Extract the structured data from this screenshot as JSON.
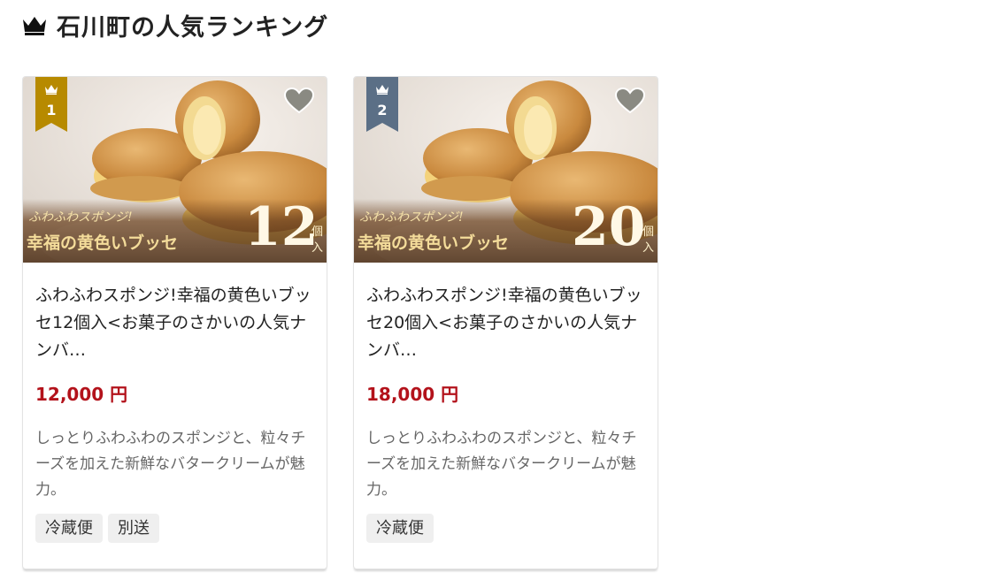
{
  "section": {
    "title": "石川町の人気ランキング",
    "icon": "crown-icon"
  },
  "products": [
    {
      "rank": "1",
      "rank_color": "#b78a00",
      "image_text_small": "ふわふわスポンジ!",
      "image_text_main": "幸福の黄色いブッセ",
      "image_count": "12",
      "image_unit_top": "個",
      "image_unit_bottom": "入",
      "name": "ふわふわスポンジ!幸福の黄色いブッセ12個入<お菓子のさかいの人気ナンバ…",
      "price": "12,000 円",
      "description": "しっとりふわふわのスポンジと、粒々チーズを加えた新鮮なバタークリームが魅力。",
      "tags": [
        "冷蔵便",
        "別送"
      ]
    },
    {
      "rank": "2",
      "rank_color": "#5b6f86",
      "image_text_small": "ふわふわスポンジ!",
      "image_text_main": "幸福の黄色いブッセ",
      "image_count": "20",
      "image_unit_top": "個",
      "image_unit_bottom": "入",
      "name": "ふわふわスポンジ!幸福の黄色いブッセ20個入<お菓子のさかいの人気ナンバ…",
      "price": "18,000 円",
      "description": "しっとりふわふわのスポンジと、粒々チーズを加えた新鮮なバタークリームが魅力。",
      "tags": [
        "冷蔵便"
      ]
    }
  ],
  "colors": {
    "price": "#b3121b",
    "heart": "#8a8a82",
    "tag_bg": "#efefef"
  }
}
